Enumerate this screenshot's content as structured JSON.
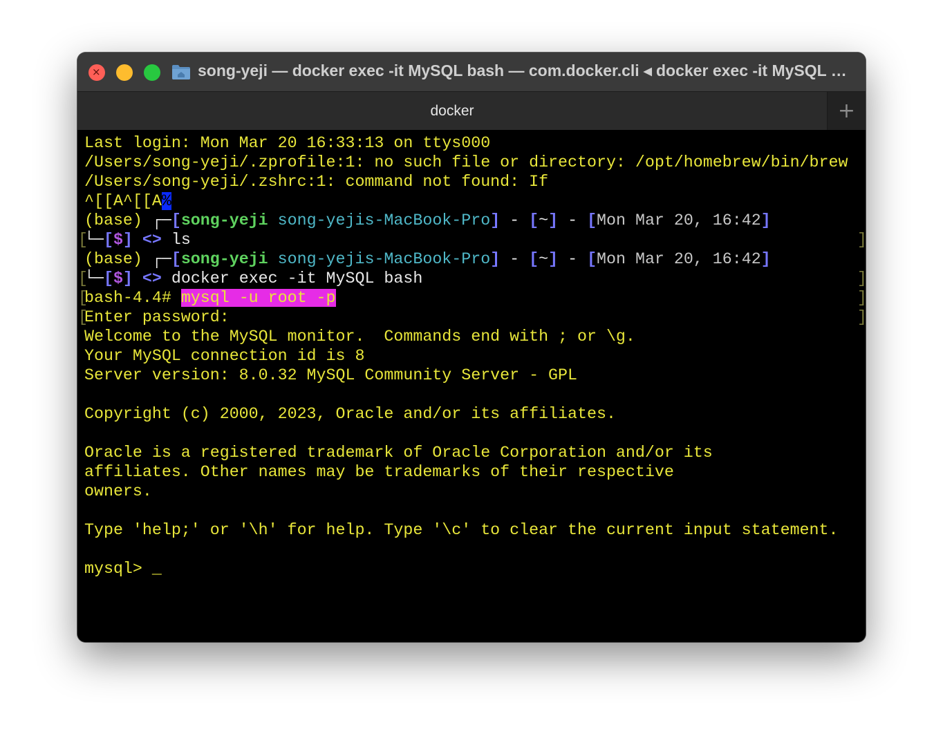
{
  "window": {
    "title": "song-yeji — docker exec -it MySQL bash — com.docker.cli ◂ docker exec -it MySQL bash",
    "close_glyph": "×"
  },
  "tabs": {
    "active_label": "docker",
    "new_tab_glyph": "+"
  },
  "colors": {
    "terminal_text": "#e8e63a",
    "username": "#5fd35f",
    "hostname": "#4fb8c8",
    "bracket": "#7777ff",
    "dollar": "#b057e0",
    "highlight": "#e62ce6",
    "cursor": "#0a2aff"
  },
  "icons": {
    "folder": "folder-icon",
    "close": "close-icon",
    "add": "plus-icon"
  },
  "terminal": {
    "last_login": "Last login: Mon Mar 20 16:33:13 on ttys000",
    "zprofile_error": "/Users/song-yeji/.zprofile:1: no such file or directory: /opt/homebrew/bin/brew",
    "zshrc_error": "/Users/song-yeji/.zshrc:1: command not found: If",
    "escape_seq": "^[[A^[[A",
    "percent_mark": "%",
    "prompt": {
      "env": "(base) ",
      "corner_top": "┌─",
      "corner_bottom": "└─",
      "open": "[",
      "close": "]",
      "user": "song-yeji",
      "host": "song-yejis-MacBook-Pro",
      "sep": " - ",
      "home": "~",
      "datetime": "Mon Mar 20, 16:42",
      "dollar": "$",
      "arrows": "<>"
    },
    "cmd1": "ls",
    "cmd2": "docker exec -it MySQL bash",
    "bash_prompt": "bash-4.4# ",
    "mysql_command": "mysql -u root -p",
    "enter_password": "Enter password:",
    "welcome": "Welcome to the MySQL monitor.  Commands end with ; or \\g.",
    "connection_id": "Your MySQL connection id is 8",
    "server_version": "Server version: 8.0.32 MySQL Community Server - GPL",
    "copyright": "Copyright (c) 2000, 2023, Oracle and/or its affiliates.",
    "trademark_1": "Oracle is a registered trademark of Oracle Corporation and/or its",
    "trademark_2": "affiliates. Other names may be trademarks of their respective",
    "trademark_3": "owners.",
    "help_line": "Type 'help;' or '\\h' for help. Type '\\c' to clear the current input statement.",
    "mysql_prompt": "mysql> ",
    "cursor": "_"
  }
}
